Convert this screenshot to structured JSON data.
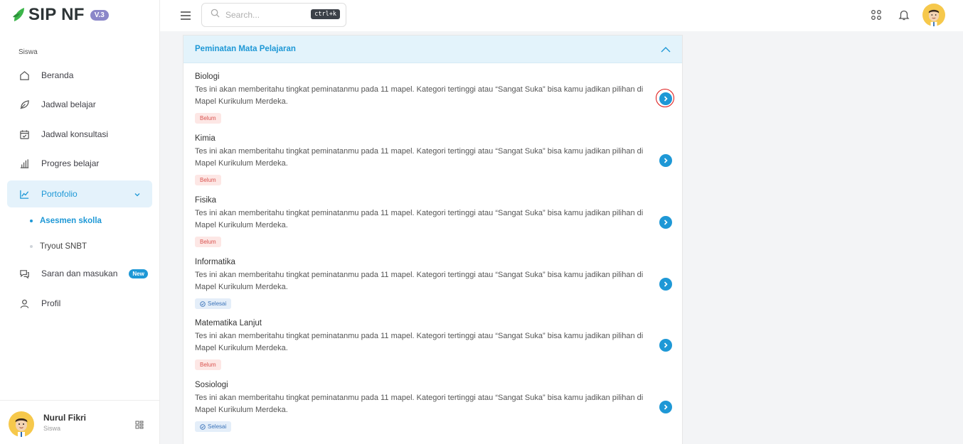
{
  "brand": {
    "name": "SIP NF",
    "version": "V.3"
  },
  "sidebar": {
    "section_label": "Siswa",
    "items": [
      {
        "label": "Beranda",
        "icon": "home-icon"
      },
      {
        "label": "Jadwal belajar",
        "icon": "leaf-icon"
      },
      {
        "label": "Jadwal konsultasi",
        "icon": "calendar-check-icon"
      },
      {
        "label": "Progres belajar",
        "icon": "bar-chart-icon"
      },
      {
        "label": "Portofolio",
        "icon": "trend-chart-icon",
        "active": true
      },
      {
        "label": "Saran dan masukan",
        "icon": "chat-icon",
        "badge": "New"
      },
      {
        "label": "Profil",
        "icon": "user-icon"
      }
    ],
    "subitems": [
      {
        "label": "Asesmen skolla",
        "active": true
      },
      {
        "label": "Tryout SNBT",
        "active": false
      }
    ],
    "user": {
      "name": "Nurul Fikri",
      "role": "Siswa"
    }
  },
  "topbar": {
    "search_placeholder": "Search...",
    "shortcut": "ctrl+k"
  },
  "card": {
    "title": "Peminatan Mata Pelajaran",
    "items": [
      {
        "name": "Biologi",
        "desc": "Tes ini akan memberitahu tingkat peminatanmu pada 11 mapel. Kategori tertinggi atau “Sangat Suka” bisa kamu jadikan pilihan di Mapel Kurikulum Merdeka.",
        "status": "Belum"
      },
      {
        "name": "Kimia",
        "desc": "Tes ini akan memberitahu tingkat peminatanmu pada 11 mapel. Kategori tertinggi atau “Sangat Suka” bisa kamu jadikan pilihan di Mapel Kurikulum Merdeka.",
        "status": "Belum"
      },
      {
        "name": "Fisika",
        "desc": "Tes ini akan memberitahu tingkat peminatanmu pada 11 mapel. Kategori tertinggi atau “Sangat Suka” bisa kamu jadikan pilihan di Mapel Kurikulum Merdeka.",
        "status": "Belum"
      },
      {
        "name": "Informatika",
        "desc": "Tes ini akan memberitahu tingkat peminatanmu pada 11 mapel. Kategori tertinggi atau “Sangat Suka” bisa kamu jadikan pilihan di Mapel Kurikulum Merdeka.",
        "status": "Selesai"
      },
      {
        "name": "Matematika Lanjut",
        "desc": "Tes ini akan memberitahu tingkat peminatanmu pada 11 mapel. Kategori tertinggi atau “Sangat Suka” bisa kamu jadikan pilihan di Mapel Kurikulum Merdeka.",
        "status": "Belum"
      },
      {
        "name": "Sosiologi",
        "desc": "Tes ini akan memberitahu tingkat peminatanmu pada 11 mapel. Kategori tertinggi atau “Sangat Suka” bisa kamu jadikan pilihan di Mapel Kurikulum Merdeka.",
        "status": "Selesai"
      }
    ]
  },
  "colors": {
    "accent": "#1e98d6",
    "brand_green": "#3cb54a",
    "belum": "#d9534f",
    "selesai": "#3b73b9"
  }
}
